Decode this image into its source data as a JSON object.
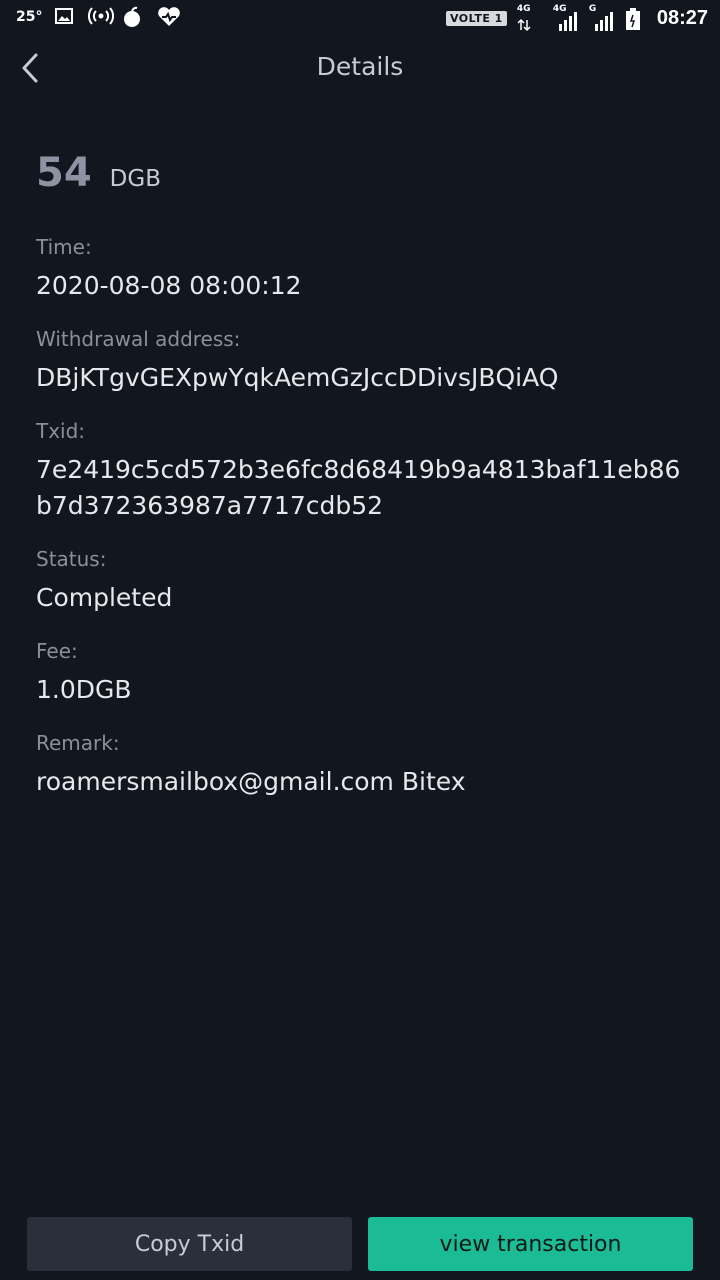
{
  "status_bar": {
    "temperature": "25°",
    "volte": "VOLTE 1",
    "net1_label": "4G",
    "net2_label": "4G",
    "net3_label": "G",
    "time": "08:27"
  },
  "header": {
    "title": "Details"
  },
  "amount": {
    "value": "54",
    "unit": "DGB"
  },
  "fields": {
    "time_label": "Time:",
    "time_value": "2020-08-08 08:00:12",
    "address_label": "Withdrawal address:",
    "address_value": "DBjKTgvGEXpwYqkAemGzJccDDivsJBQiAQ",
    "txid_label": "Txid:",
    "txid_value": "7e2419c5cd572b3e6fc8d68419b9a4813baf11eb86b7d372363987a7717cdb52",
    "status_label": "Status:",
    "status_value": "Completed",
    "fee_label": "Fee:",
    "fee_value": "1.0DGB",
    "remark_label": "Remark:",
    "remark_value": "roamersmailbox@gmail.com Bitex"
  },
  "buttons": {
    "copy_txid": "Copy Txid",
    "view_transaction": "view transaction"
  },
  "colors": {
    "background": "#12161f",
    "accent": "#1bbc95",
    "secondary_button": "#2a2f3b"
  }
}
